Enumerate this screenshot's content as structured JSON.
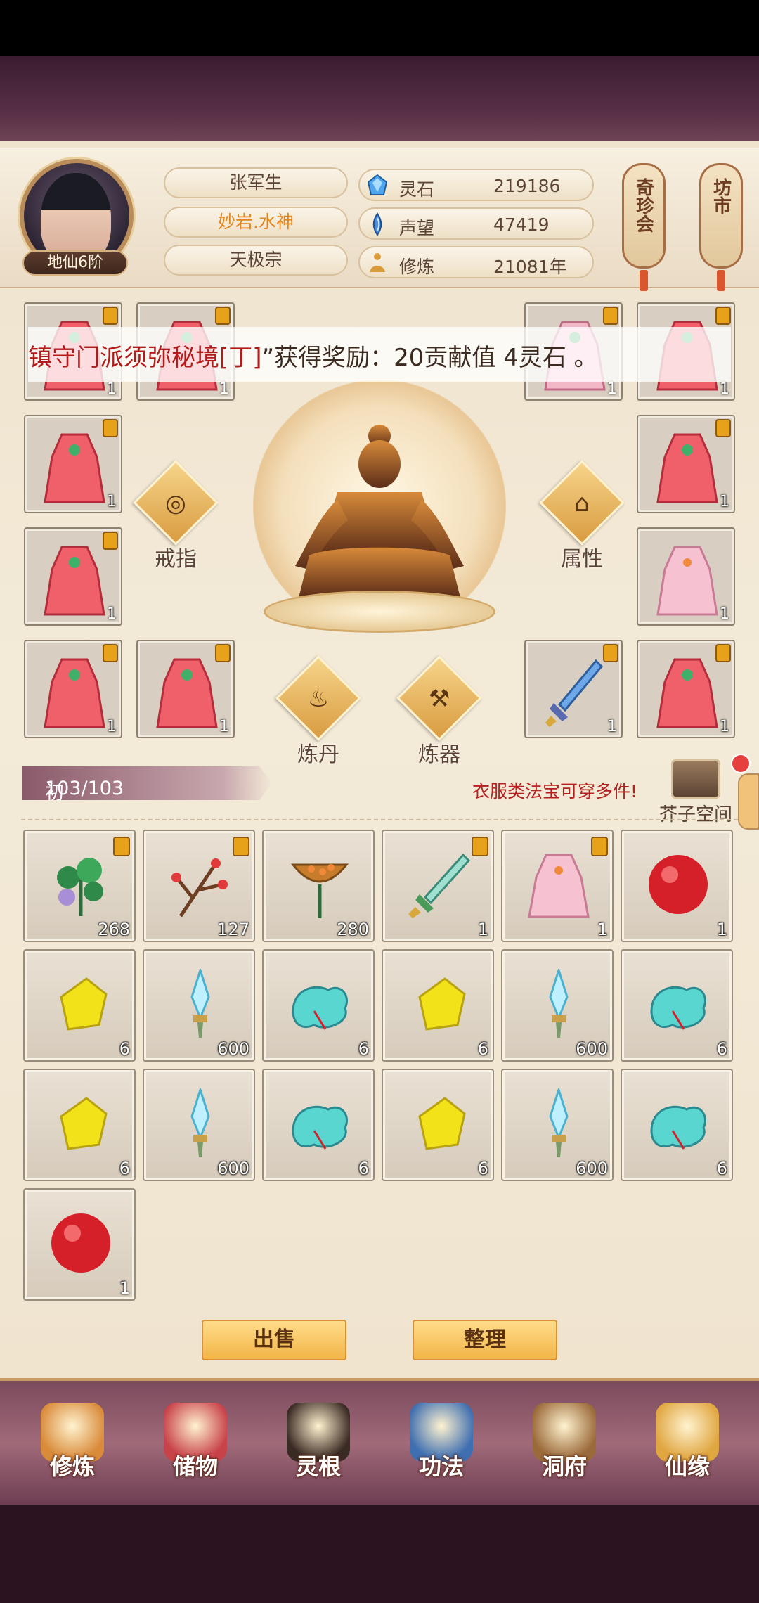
{
  "player": {
    "name": "张军生",
    "title": "妙岩.水神",
    "sect": "天极宗",
    "rank": "地仙6阶"
  },
  "resources": [
    {
      "label": "灵石",
      "value": "219186",
      "icon": "spirit-stone-icon"
    },
    {
      "label": "声望",
      "value": "47419",
      "icon": "reputation-icon"
    },
    {
      "label": "修炼",
      "value": "21081年",
      "icon": "cultivation-icon"
    }
  ],
  "lanterns": [
    {
      "label": "奇珍会"
    },
    {
      "label": "坊市"
    }
  ],
  "notice": {
    "red": "镇守门派须弥秘境[丁]",
    "rest": "”获得奖励：20贡献值 4灵石 。"
  },
  "equipment": {
    "slot_counts": [
      "1",
      "1",
      "1",
      "1",
      "1",
      "1",
      "1",
      "1",
      "1",
      "1",
      "1",
      "1"
    ],
    "actions": {
      "ring": "戒指",
      "attributes": "属性",
      "alchemy": "炼丹",
      "forge": "炼器"
    }
  },
  "storage": {
    "name": "初级储物手镯",
    "capacity": "103/103",
    "tip": "衣服类法宝可穿多件!",
    "space_label": "芥子空间"
  },
  "bag_items": [
    {
      "icon": "herb-icon",
      "count": "268",
      "locked": true
    },
    {
      "icon": "branch-icon",
      "count": "127",
      "locked": true
    },
    {
      "icon": "lotus-pod-icon",
      "count": "280",
      "locked": false
    },
    {
      "icon": "sword-icon",
      "count": "1",
      "locked": true
    },
    {
      "icon": "robe-icon",
      "count": "1",
      "locked": true
    },
    {
      "icon": "red-orb-icon",
      "count": "1",
      "locked": false
    },
    {
      "icon": "gold-ore-icon",
      "count": "6",
      "locked": false
    },
    {
      "icon": "crystal-blade-icon",
      "count": "600",
      "locked": false
    },
    {
      "icon": "jade-cloud-icon",
      "count": "6",
      "locked": false
    },
    {
      "icon": "gold-ore-icon",
      "count": "6",
      "locked": false
    },
    {
      "icon": "crystal-blade-icon",
      "count": "600",
      "locked": false
    },
    {
      "icon": "jade-cloud-icon",
      "count": "6",
      "locked": false
    },
    {
      "icon": "gold-ore-icon",
      "count": "6",
      "locked": false
    },
    {
      "icon": "crystal-blade-icon",
      "count": "600",
      "locked": false
    },
    {
      "icon": "jade-cloud-icon",
      "count": "6",
      "locked": false
    },
    {
      "icon": "gold-ore-icon",
      "count": "6",
      "locked": false
    },
    {
      "icon": "crystal-blade-icon",
      "count": "600",
      "locked": false
    },
    {
      "icon": "jade-cloud-icon",
      "count": "6",
      "locked": false
    },
    {
      "icon": "red-orb-icon",
      "count": "1",
      "locked": false
    }
  ],
  "buttons": {
    "sell": "出售",
    "sort": "整理"
  },
  "nav": [
    {
      "label": "修炼",
      "icon": "cultivate-nav-icon",
      "color": "#d98b3a"
    },
    {
      "label": "储物",
      "icon": "storage-nav-icon",
      "color": "#c8424a"
    },
    {
      "label": "灵根",
      "icon": "spirit-root-nav-icon",
      "color": "#3a2a24"
    },
    {
      "label": "功法",
      "icon": "technique-nav-icon",
      "color": "#3f6fb0"
    },
    {
      "label": "洞府",
      "icon": "cave-nav-icon",
      "color": "#9b6a3a"
    },
    {
      "label": "仙缘",
      "icon": "fortune-nav-icon",
      "color": "#e0a640"
    }
  ],
  "colors": {
    "accent_gold": "#f2b547",
    "notice_red": "#b31b1b",
    "title_orange": "#e0861c"
  }
}
